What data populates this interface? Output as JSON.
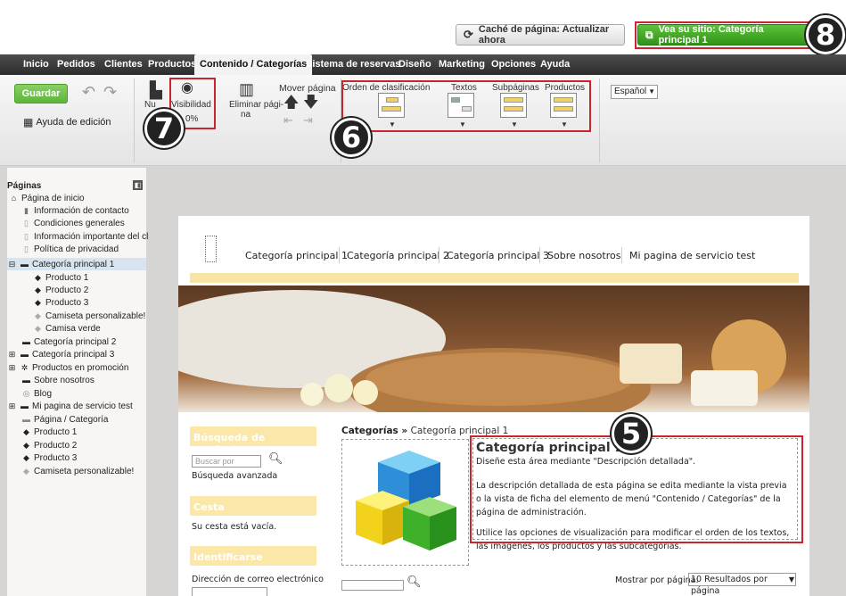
{
  "top": {
    "cache_label": "Caché de página: Actualizar ahora",
    "site_label": "Vea su sitio: Categoría principal 1"
  },
  "menu": [
    "Inicio",
    "Pedidos",
    "Clientes",
    "Productos",
    "Contenido / Categorías",
    "Sistema de reservas",
    "Diseño",
    "Marketing",
    "Opciones",
    "Ayuda"
  ],
  "ribbon": {
    "save": "Guardar",
    "edit_help": "Ayuda de edición",
    "new_short": "Nu",
    "visibility": "Visibilidad",
    "visibility_pct": "0%",
    "delete_line1": "Eliminar pági-",
    "delete_line2": "na",
    "move_page": "Mover página",
    "sort_order": "Orden de clasificación",
    "texts": "Textos",
    "subpages": "Subpáginas",
    "products": "Productos",
    "language": "Español"
  },
  "badges": {
    "b5": "5",
    "b6": "6",
    "b7": "7",
    "b8": "8"
  },
  "sidebar": {
    "title": "Páginas",
    "items": [
      "Página de inicio",
      "Información de contacto",
      "Condiciones generales",
      "Información importante del cl",
      "Política de privacidad",
      "Categoría principal 1",
      "Producto 1",
      "Producto 2",
      "Producto 3",
      "Camiseta personalizable!",
      "Camisa verde",
      "Categoría principal 2",
      "Categoría principal 3",
      "Productos en promoción",
      "Sobre nosotros",
      "Blog",
      "Mi pagina de servicio test",
      "Página / Categoría",
      "Producto 1",
      "Producto 2",
      "Producto 3",
      "Camiseta personalizable!"
    ]
  },
  "site": {
    "nav": [
      "Categoría principal 1",
      "Categoría principal 2",
      "Categoría principal 3",
      "Sobre nosotros",
      "Mi pagina de servicio test"
    ],
    "search_title": "Búsqueda de productos",
    "search_placeholder": "Buscar por",
    "advanced_search": "Búsqueda avanzada",
    "cart_title": "Cesta",
    "cart_empty": "Su cesta está vacía.",
    "login_title": "Identificarse",
    "email_label": "Dirección de correo electrónico",
    "breadcrumb_root": "Categorías »",
    "breadcrumb_current": "Categoría principal 1",
    "heading": "Categoría principal 1",
    "desc1": "Diseñe esta área mediante \"Descripción detallada\".",
    "desc2": "La descripción detallada de esta página se edita mediante la vista previa o la vista de ficha del elemento de menú \"Contenido / Categorías\" de la página de administración.",
    "desc3": "Utilice las opciones de visualización para modificar el orden de los textos, las imágenes, los productos y las subcategorías.",
    "per_page_label": "Mostrar por página:",
    "per_page_value": "10 Resultados por página"
  },
  "colors": {
    "accent_red": "#c9252d",
    "green": "#3a9d1f",
    "menu_dark": "#3a3a3a",
    "panel_yellow": "#fbe7a8"
  }
}
